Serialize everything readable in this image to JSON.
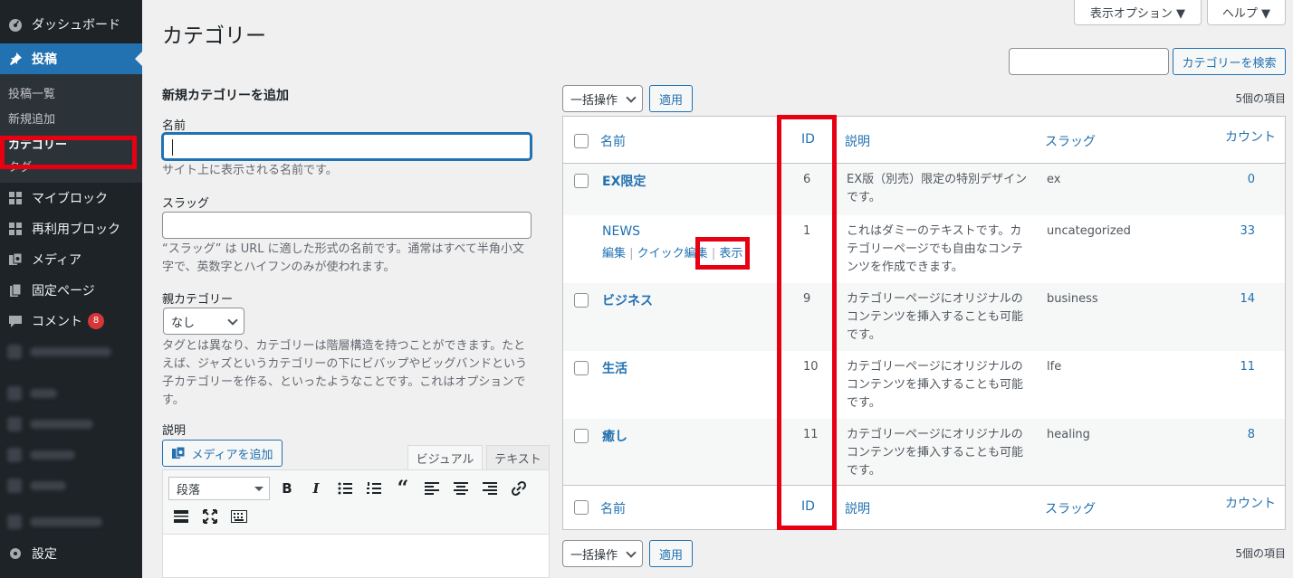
{
  "sidebar": {
    "dashboard": "ダッシュボード",
    "posts": "投稿",
    "posts_submenu": [
      "投稿一覧",
      "新規追加",
      "カテゴリー",
      "タグ"
    ],
    "myblocks": "マイブロック",
    "reusable_blocks": "再利用ブロック",
    "media": "メディア",
    "pages": "固定ページ",
    "comments": "コメント",
    "comments_badge": "8",
    "settings": "設定"
  },
  "top_buttons": {
    "screen_options": "表示オプション ▼",
    "help": "ヘルプ ▼"
  },
  "page_title": "カテゴリー",
  "search": {
    "placeholder": "",
    "button": "カテゴリーを検索"
  },
  "form": {
    "heading": "新規カテゴリーを追加",
    "name_label": "名前",
    "name_hint": "サイト上に表示される名前です。",
    "slug_label": "スラッグ",
    "slug_hint_1": "“スラッグ” は URL に適した形式の名前です。通常はすべて半角小文",
    "slug_hint_2": "字で、英数字とハイフンのみが使われます。",
    "parent_label": "親カテゴリー",
    "parent_value": "なし",
    "parent_hint_1": "タグとは異なり、カテゴリーは階層構造を持つことができます。たと",
    "parent_hint_2": "えば、ジャズというカテゴリーの下にビバップやビッグバンドという",
    "parent_hint_3": "子カテゴリーを作る、といったようなことです。これはオプションで",
    "parent_hint_4": "す。",
    "description_label": "説明",
    "media_button": "メディアを追加",
    "tab_visual": "ビジュアル",
    "tab_text": "テキスト",
    "format_select": "段落"
  },
  "bulk": {
    "action": "一括操作",
    "apply": "適用",
    "items": "5個の項目"
  },
  "table": {
    "headers": {
      "name": "名前",
      "id": "ID",
      "description": "説明",
      "slug": "スラッグ",
      "count": "カウント"
    },
    "rows": [
      {
        "name": "EX限定",
        "id": "6",
        "desc": [
          "EX版（別売）限定の特別デザイン",
          "です。"
        ],
        "slug": "ex",
        "count": "0"
      },
      {
        "name": "NEWS",
        "id": "1",
        "desc": [
          "これはダミーのテキストです。カ",
          "テゴリーページでも自由なコンテ",
          "ンツを作成できます。"
        ],
        "slug": "uncategorized",
        "count": "33"
      },
      {
        "name": "ビジネス",
        "id": "9",
        "desc": [
          "カテゴリーページにオリジナルの",
          "コンテンツを挿入することも可能",
          "です。"
        ],
        "slug": "business",
        "count": "14"
      },
      {
        "name": "生活",
        "id": "10",
        "desc": [
          "カテゴリーページにオリジナルの",
          "コンテンツを挿入することも可能",
          "です。"
        ],
        "slug": "lfe",
        "count": "11"
      },
      {
        "name": "癒し",
        "id": "11",
        "desc": [
          "カテゴリーページにオリジナルの",
          "コンテンツを挿入することも可能",
          "です。"
        ],
        "slug": "healing",
        "count": "8"
      }
    ],
    "row_actions": {
      "edit": "編集",
      "quick_edit": "クイック編集",
      "view": "表示"
    }
  }
}
